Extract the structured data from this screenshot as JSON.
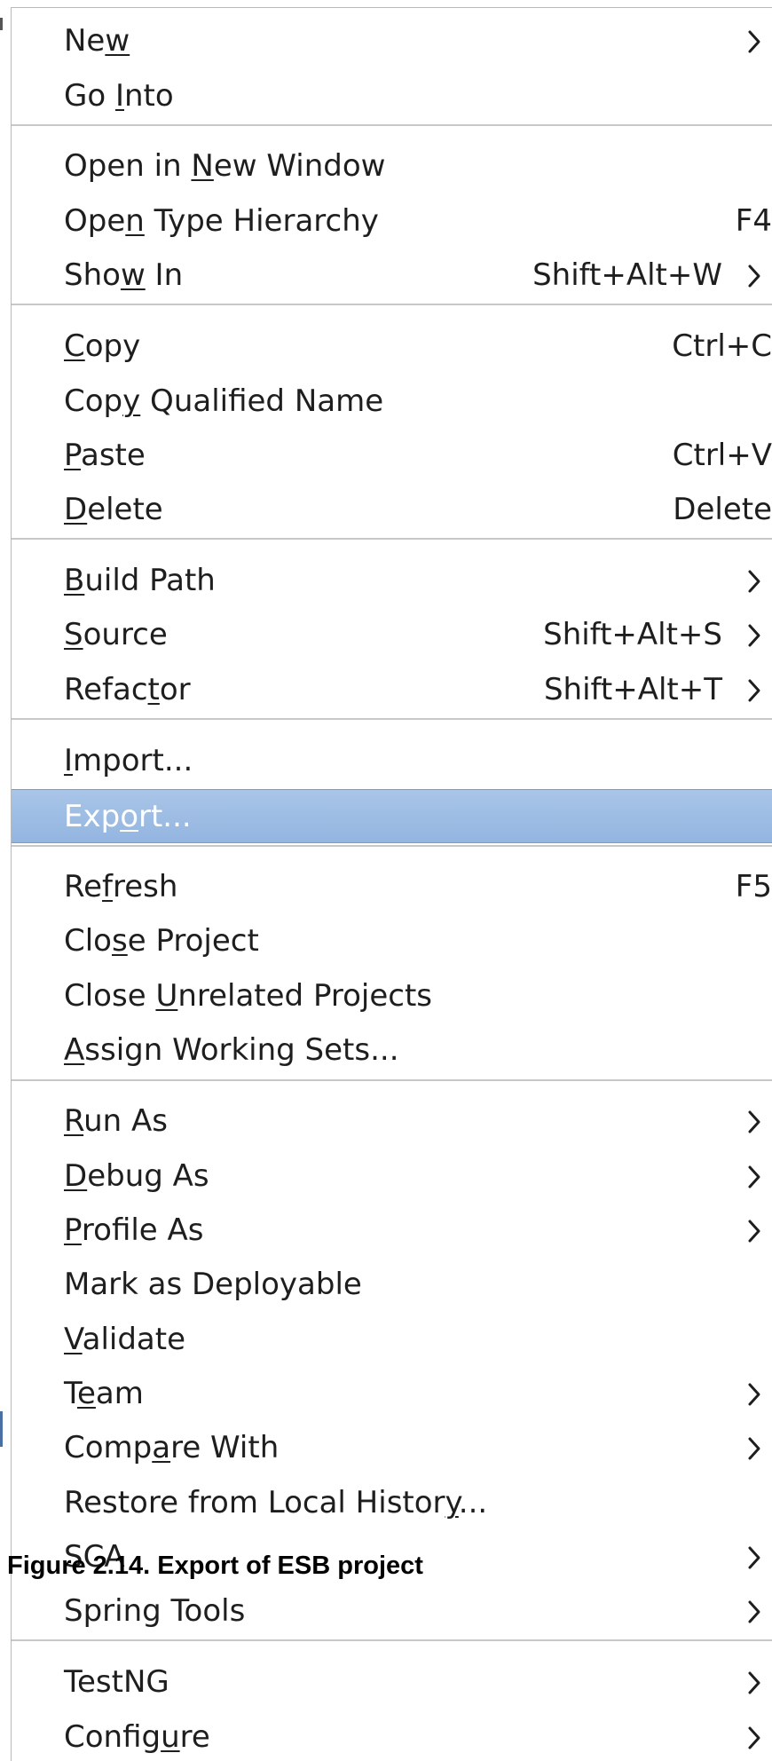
{
  "menu": {
    "items": [
      {
        "label": "New",
        "mnemonic_index": 2,
        "shortcut": "",
        "submenu": true
      },
      {
        "label": "Go Into",
        "mnemonic_index": 3,
        "shortcut": "",
        "submenu": false
      },
      {
        "label": "Open in New Window",
        "mnemonic_index": 8,
        "shortcut": "",
        "submenu": false
      },
      {
        "label": "Open Type Hierarchy",
        "mnemonic_index": 3,
        "shortcut": "F4",
        "submenu": false
      },
      {
        "label": "Show In",
        "mnemonic_index": 3,
        "shortcut": "Shift+Alt+W",
        "submenu": true
      },
      {
        "label": "Copy",
        "mnemonic_index": 0,
        "shortcut": "Ctrl+C",
        "submenu": false
      },
      {
        "label": "Copy Qualified Name",
        "mnemonic_index": 3,
        "shortcut": "",
        "submenu": false
      },
      {
        "label": "Paste",
        "mnemonic_index": 0,
        "shortcut": "Ctrl+V",
        "submenu": false
      },
      {
        "label": "Delete",
        "mnemonic_index": 0,
        "shortcut": "Delete",
        "submenu": false
      },
      {
        "label": "Build Path",
        "mnemonic_index": 0,
        "shortcut": "",
        "submenu": true
      },
      {
        "label": "Source",
        "mnemonic_index": 0,
        "shortcut": "Shift+Alt+S",
        "submenu": true
      },
      {
        "label": "Refactor",
        "mnemonic_index": 5,
        "shortcut": "Shift+Alt+T",
        "submenu": true
      },
      {
        "label": "Import...",
        "mnemonic_index": 0,
        "shortcut": "",
        "submenu": false
      },
      {
        "label": "Export...",
        "mnemonic_index": 3,
        "shortcut": "",
        "submenu": false,
        "selected": true
      },
      {
        "label": "Refresh",
        "mnemonic_index": 2,
        "shortcut": "F5",
        "submenu": false
      },
      {
        "label": "Close Project",
        "mnemonic_index": 3,
        "shortcut": "",
        "submenu": false
      },
      {
        "label": "Close Unrelated Projects",
        "mnemonic_index": 6,
        "shortcut": "",
        "submenu": false
      },
      {
        "label": "Assign Working Sets...",
        "mnemonic_index": 0,
        "shortcut": "",
        "submenu": false
      },
      {
        "label": "Run As",
        "mnemonic_index": 0,
        "shortcut": "",
        "submenu": true
      },
      {
        "label": "Debug As",
        "mnemonic_index": 0,
        "shortcut": "",
        "submenu": true
      },
      {
        "label": "Profile As",
        "mnemonic_index": 0,
        "shortcut": "",
        "submenu": true
      },
      {
        "label": "Mark as Deployable",
        "mnemonic_index": -1,
        "shortcut": "",
        "submenu": false
      },
      {
        "label": "Validate",
        "mnemonic_index": 0,
        "shortcut": "",
        "submenu": false
      },
      {
        "label": "Team",
        "mnemonic_index": 1,
        "shortcut": "",
        "submenu": true
      },
      {
        "label": "Compare With",
        "mnemonic_index": 4,
        "shortcut": "",
        "submenu": true
      },
      {
        "label": "Restore from Local History...",
        "mnemonic_index": 25,
        "shortcut": "",
        "submenu": false
      },
      {
        "label": "SCA",
        "mnemonic_index": -1,
        "shortcut": "",
        "submenu": true
      },
      {
        "label": "Spring Tools",
        "mnemonic_index": -1,
        "shortcut": "",
        "submenu": true
      },
      {
        "label": "TestNG",
        "mnemonic_index": -1,
        "shortcut": "",
        "submenu": true
      },
      {
        "label": "Configure",
        "mnemonic_index": 6,
        "shortcut": "",
        "submenu": true
      }
    ]
  },
  "caption": "Figure 2.14. Export of ESB project",
  "colors": {
    "selected_bg": "#a9c5e8",
    "separator": "#c8c8c8",
    "text": "#1e1e1e"
  }
}
